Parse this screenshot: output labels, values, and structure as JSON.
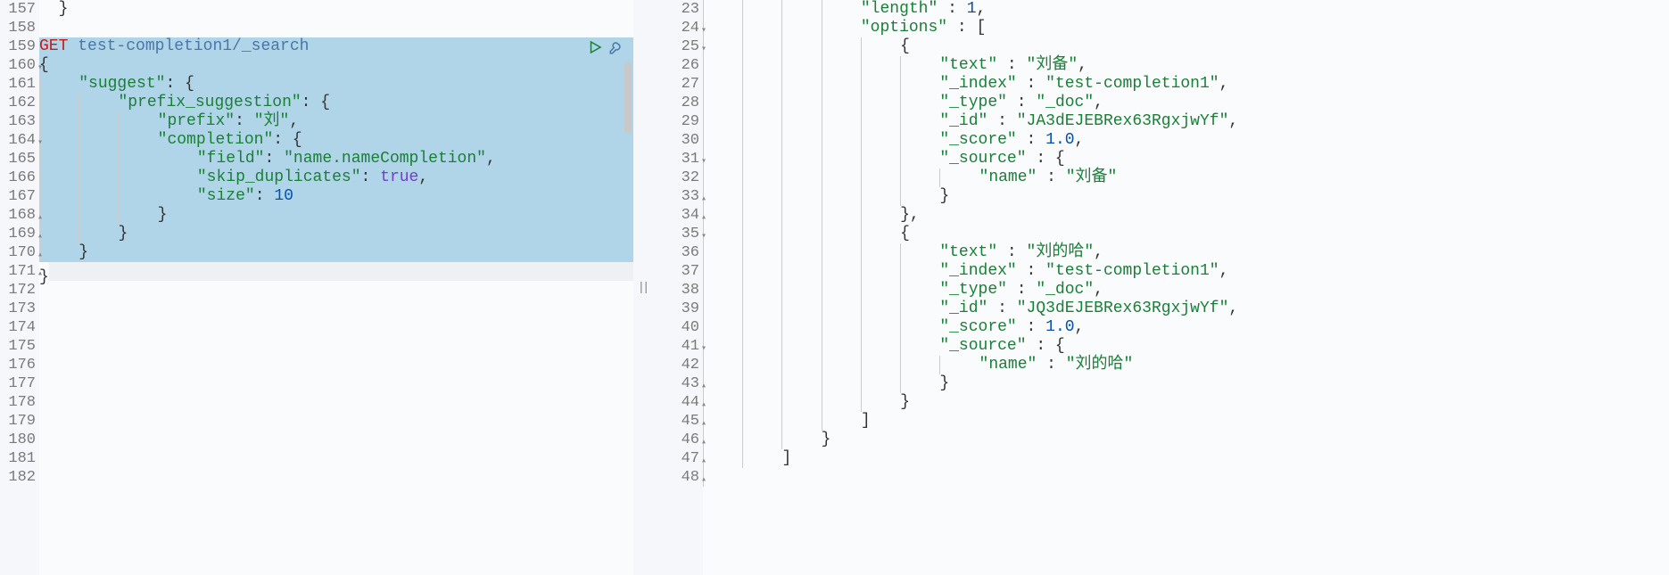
{
  "left_gutter_start": 157,
  "left_gutter_end": 182,
  "right_gutter_start": 23,
  "right_gutter_end": 48,
  "left_fold_down": [
    160,
    164
  ],
  "left_fold_up": [
    168,
    169,
    170,
    171
  ],
  "right_fold_down": [
    24,
    25,
    31,
    35,
    41
  ],
  "right_fold_up": [
    33,
    34,
    43,
    44,
    45,
    46,
    47,
    48
  ],
  "request": {
    "method": "GET",
    "url": "test-completion1/_search",
    "body_lines": [
      "{",
      "    \"suggest\": {",
      "        \"prefix_suggestion\": {",
      "            \"prefix\": \"刘\",",
      "            \"completion\": {",
      "                \"field\": \"name.nameCompletion\",",
      "                \"skip_duplicates\": true,",
      "                \"size\": 10",
      "            }",
      "        }",
      "    }",
      "}"
    ]
  },
  "response_lines": [
    {
      "indent": 4,
      "content": [
        {
          "t": "key",
          "v": "\"length\""
        },
        {
          "t": "punc",
          "v": " : "
        },
        {
          "t": "num",
          "v": "1"
        },
        {
          "t": "punc",
          "v": ","
        }
      ]
    },
    {
      "indent": 4,
      "content": [
        {
          "t": "key",
          "v": "\"options\""
        },
        {
          "t": "punc",
          "v": " : ["
        }
      ]
    },
    {
      "indent": 5,
      "content": [
        {
          "t": "punc",
          "v": "{"
        }
      ]
    },
    {
      "indent": 6,
      "content": [
        {
          "t": "key",
          "v": "\"text\""
        },
        {
          "t": "punc",
          "v": " : "
        },
        {
          "t": "str",
          "v": "\"刘备\""
        },
        {
          "t": "punc",
          "v": ","
        }
      ]
    },
    {
      "indent": 6,
      "content": [
        {
          "t": "key",
          "v": "\"_index\""
        },
        {
          "t": "punc",
          "v": " : "
        },
        {
          "t": "str",
          "v": "\"test-completion1\""
        },
        {
          "t": "punc",
          "v": ","
        }
      ]
    },
    {
      "indent": 6,
      "content": [
        {
          "t": "key",
          "v": "\"_type\""
        },
        {
          "t": "punc",
          "v": " : "
        },
        {
          "t": "str",
          "v": "\"_doc\""
        },
        {
          "t": "punc",
          "v": ","
        }
      ]
    },
    {
      "indent": 6,
      "content": [
        {
          "t": "key",
          "v": "\"_id\""
        },
        {
          "t": "punc",
          "v": " : "
        },
        {
          "t": "str",
          "v": "\"JA3dEJEBRex63RgxjwYf\""
        },
        {
          "t": "punc",
          "v": ","
        }
      ]
    },
    {
      "indent": 6,
      "content": [
        {
          "t": "key",
          "v": "\"_score\""
        },
        {
          "t": "punc",
          "v": " : "
        },
        {
          "t": "num",
          "v": "1.0"
        },
        {
          "t": "punc",
          "v": ","
        }
      ]
    },
    {
      "indent": 6,
      "content": [
        {
          "t": "key",
          "v": "\"_source\""
        },
        {
          "t": "punc",
          "v": " : {"
        }
      ]
    },
    {
      "indent": 7,
      "content": [
        {
          "t": "key",
          "v": "\"name\""
        },
        {
          "t": "punc",
          "v": " : "
        },
        {
          "t": "str",
          "v": "\"刘备\""
        }
      ]
    },
    {
      "indent": 6,
      "content": [
        {
          "t": "punc",
          "v": "}"
        }
      ]
    },
    {
      "indent": 5,
      "content": [
        {
          "t": "punc",
          "v": "},"
        }
      ]
    },
    {
      "indent": 5,
      "content": [
        {
          "t": "punc",
          "v": "{"
        }
      ]
    },
    {
      "indent": 6,
      "content": [
        {
          "t": "key",
          "v": "\"text\""
        },
        {
          "t": "punc",
          "v": " : "
        },
        {
          "t": "str",
          "v": "\"刘的哈\""
        },
        {
          "t": "punc",
          "v": ","
        }
      ]
    },
    {
      "indent": 6,
      "content": [
        {
          "t": "key",
          "v": "\"_index\""
        },
        {
          "t": "punc",
          "v": " : "
        },
        {
          "t": "str",
          "v": "\"test-completion1\""
        },
        {
          "t": "punc",
          "v": ","
        }
      ]
    },
    {
      "indent": 6,
      "content": [
        {
          "t": "key",
          "v": "\"_type\""
        },
        {
          "t": "punc",
          "v": " : "
        },
        {
          "t": "str",
          "v": "\"_doc\""
        },
        {
          "t": "punc",
          "v": ","
        }
      ]
    },
    {
      "indent": 6,
      "content": [
        {
          "t": "key",
          "v": "\"_id\""
        },
        {
          "t": "punc",
          "v": " : "
        },
        {
          "t": "str",
          "v": "\"JQ3dEJEBRex63RgxjwYf\""
        },
        {
          "t": "punc",
          "v": ","
        }
      ]
    },
    {
      "indent": 6,
      "content": [
        {
          "t": "key",
          "v": "\"_score\""
        },
        {
          "t": "punc",
          "v": " : "
        },
        {
          "t": "num",
          "v": "1.0"
        },
        {
          "t": "punc",
          "v": ","
        }
      ]
    },
    {
      "indent": 6,
      "content": [
        {
          "t": "key",
          "v": "\"_source\""
        },
        {
          "t": "punc",
          "v": " : {"
        }
      ]
    },
    {
      "indent": 7,
      "content": [
        {
          "t": "key",
          "v": "\"name\""
        },
        {
          "t": "punc",
          "v": " : "
        },
        {
          "t": "str",
          "v": "\"刘的哈\""
        }
      ]
    },
    {
      "indent": 6,
      "content": [
        {
          "t": "punc",
          "v": "}"
        }
      ]
    },
    {
      "indent": 5,
      "content": [
        {
          "t": "punc",
          "v": "}"
        }
      ]
    },
    {
      "indent": 4,
      "content": [
        {
          "t": "punc",
          "v": "]"
        }
      ]
    },
    {
      "indent": 3,
      "content": [
        {
          "t": "punc",
          "v": "}"
        }
      ]
    },
    {
      "indent": 2,
      "content": [
        {
          "t": "punc",
          "v": "]"
        }
      ]
    },
    {
      "indent": 1,
      "content": []
    }
  ],
  "left_pre_lines": [
    "  }",
    ""
  ],
  "icons": {
    "run": "run-icon",
    "wrench": "wrench-icon"
  }
}
